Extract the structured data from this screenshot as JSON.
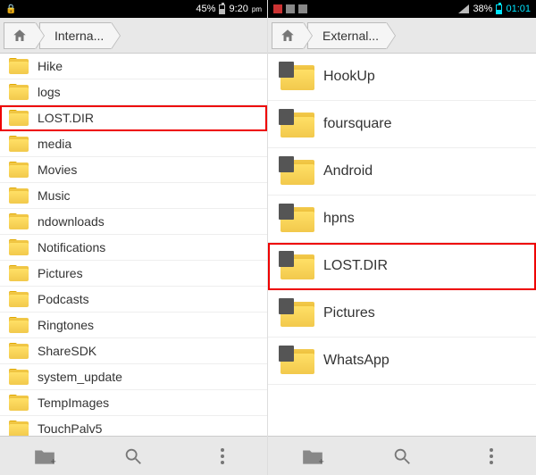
{
  "left": {
    "status": {
      "battery_pct": "45%",
      "time": "9:20",
      "ampm": "pm"
    },
    "breadcrumb": {
      "label": "Interna..."
    },
    "folders": [
      {
        "name": "Hike",
        "highlight": false
      },
      {
        "name": "logs",
        "highlight": false
      },
      {
        "name": "LOST.DIR",
        "highlight": true
      },
      {
        "name": "media",
        "highlight": false
      },
      {
        "name": "Movies",
        "highlight": false
      },
      {
        "name": "Music",
        "highlight": false
      },
      {
        "name": "ndownloads",
        "highlight": false
      },
      {
        "name": "Notifications",
        "highlight": false
      },
      {
        "name": "Pictures",
        "highlight": false
      },
      {
        "name": "Podcasts",
        "highlight": false
      },
      {
        "name": "Ringtones",
        "highlight": false
      },
      {
        "name": "ShareSDK",
        "highlight": false
      },
      {
        "name": "system_update",
        "highlight": false
      },
      {
        "name": "TempImages",
        "highlight": false
      },
      {
        "name": "TouchPalv5",
        "highlight": false
      }
    ]
  },
  "right": {
    "status": {
      "battery_pct": "38%",
      "time": "01:01"
    },
    "breadcrumb": {
      "label": "External..."
    },
    "folders": [
      {
        "name": "HookUp",
        "highlight": false
      },
      {
        "name": "foursquare",
        "highlight": false
      },
      {
        "name": "Android",
        "highlight": false
      },
      {
        "name": "hpns",
        "highlight": false
      },
      {
        "name": "LOST.DIR",
        "highlight": true
      },
      {
        "name": "Pictures",
        "highlight": false
      },
      {
        "name": "WhatsApp",
        "highlight": false
      }
    ]
  }
}
